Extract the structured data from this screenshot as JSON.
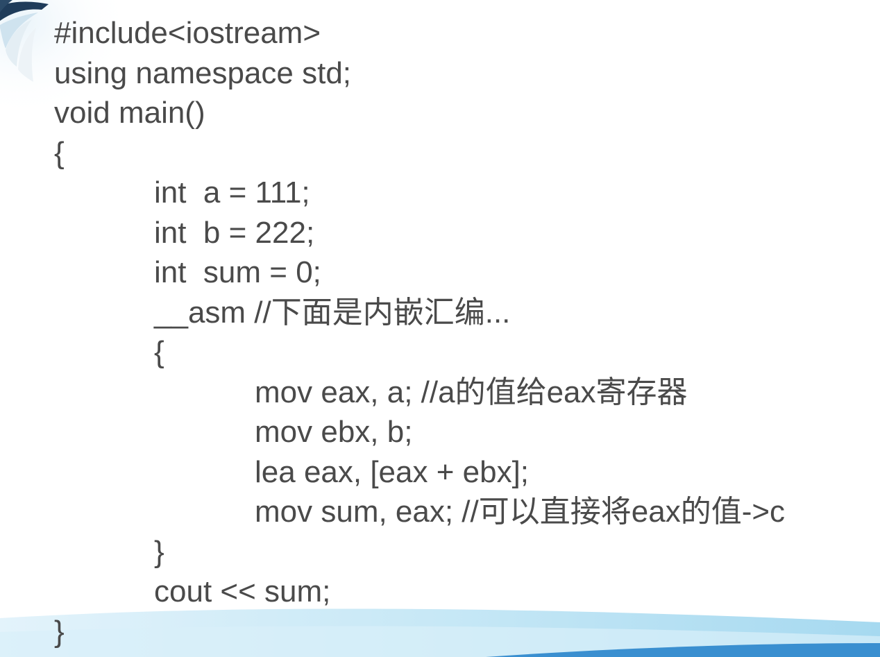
{
  "slide": {
    "code_lines": [
      {
        "text": "#include<iostream>",
        "indent": 0
      },
      {
        "text": "using namespace std;",
        "indent": 0
      },
      {
        "text": "void main()",
        "indent": 0
      },
      {
        "text": "{",
        "indent": 0
      },
      {
        "text": "int  a = 111;",
        "indent": 1
      },
      {
        "text": "int  b = 222;",
        "indent": 1
      },
      {
        "text": "int  sum = 0;",
        "indent": 1
      },
      {
        "text": "__asm //下面是内嵌汇编...",
        "indent": 1
      },
      {
        "text": "{",
        "indent": 1
      },
      {
        "text": "mov eax, a; //a的值给eax寄存器",
        "indent": 2
      },
      {
        "text": "mov ebx, b;",
        "indent": 2
      },
      {
        "text": "lea eax, [eax + ebx];",
        "indent": 2
      },
      {
        "text": "mov sum, eax; //可以直接将eax的值->c",
        "indent": 2
      },
      {
        "text": "}",
        "indent": 1
      },
      {
        "text": "cout << sum;",
        "indent": 1
      },
      {
        "text": "}",
        "indent": 0
      }
    ]
  },
  "colors": {
    "text": "#4a4a4a",
    "background": "#ffffff",
    "wave_light": "#d6eef8",
    "wave_mid": "#a9dcf2",
    "wave_accent": "#3a8fd0"
  }
}
